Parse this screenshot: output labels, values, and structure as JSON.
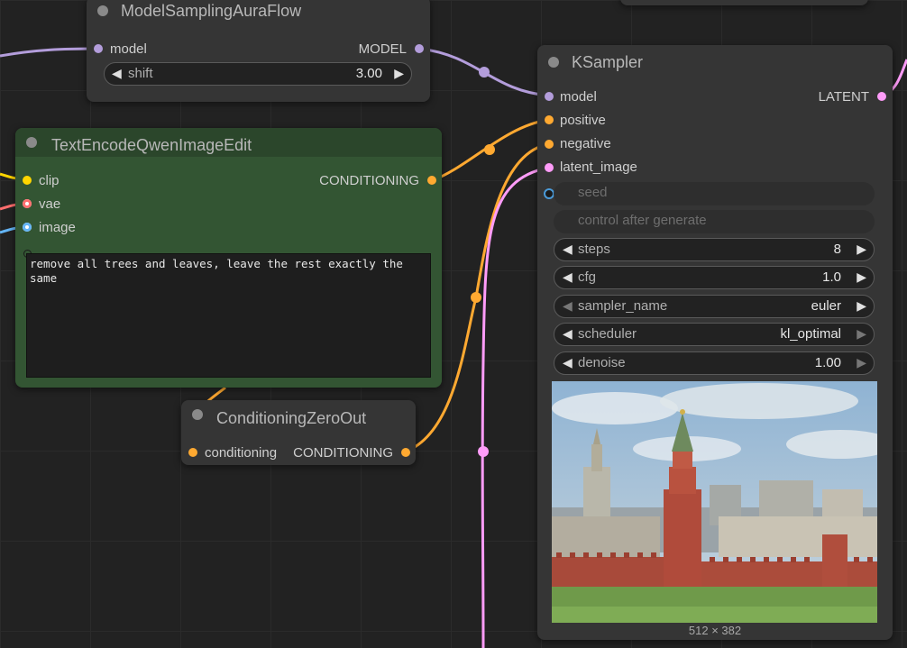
{
  "nodes": {
    "model_sampling": {
      "title": "ModelSamplingAuraFlow",
      "input_model": "model",
      "output_model": "MODEL",
      "shift_label": "shift",
      "shift_value": "3.00"
    },
    "text_encode": {
      "title": "TextEncodeQwenImageEdit",
      "input_clip": "clip",
      "input_vae": "vae",
      "input_image": "image",
      "output_conditioning": "CONDITIONING",
      "prompt": "remove all trees and leaves, leave the rest exactly the same"
    },
    "cond_zero": {
      "title": "ConditioningZeroOut",
      "input_conditioning": "conditioning",
      "output_conditioning": "CONDITIONING"
    },
    "ksampler": {
      "title": "KSampler",
      "input_model": "model",
      "input_positive": "positive",
      "input_negative": "negative",
      "input_latent": "latent_image",
      "output_latent": "LATENT",
      "seed_label": "seed",
      "control_label": "control after generate",
      "steps_label": "steps",
      "steps_value": "8",
      "cfg_label": "cfg",
      "cfg_value": "1.0",
      "sampler_label": "sampler_name",
      "sampler_value": "euler",
      "scheduler_label": "scheduler",
      "scheduler_value": "kl_optimal",
      "denoise_label": "denoise",
      "denoise_value": "1.00",
      "preview_caption": "512 × 382"
    }
  },
  "colors": {
    "model": "#b39ddb",
    "conditioning": "#ffa931",
    "latent": "#ff9cf9",
    "clip": "#ffd500",
    "vae": "#ff6e6e",
    "image": "#64b5f6",
    "text_node_bg": "#335533",
    "text_node_title": "#2b462b"
  }
}
